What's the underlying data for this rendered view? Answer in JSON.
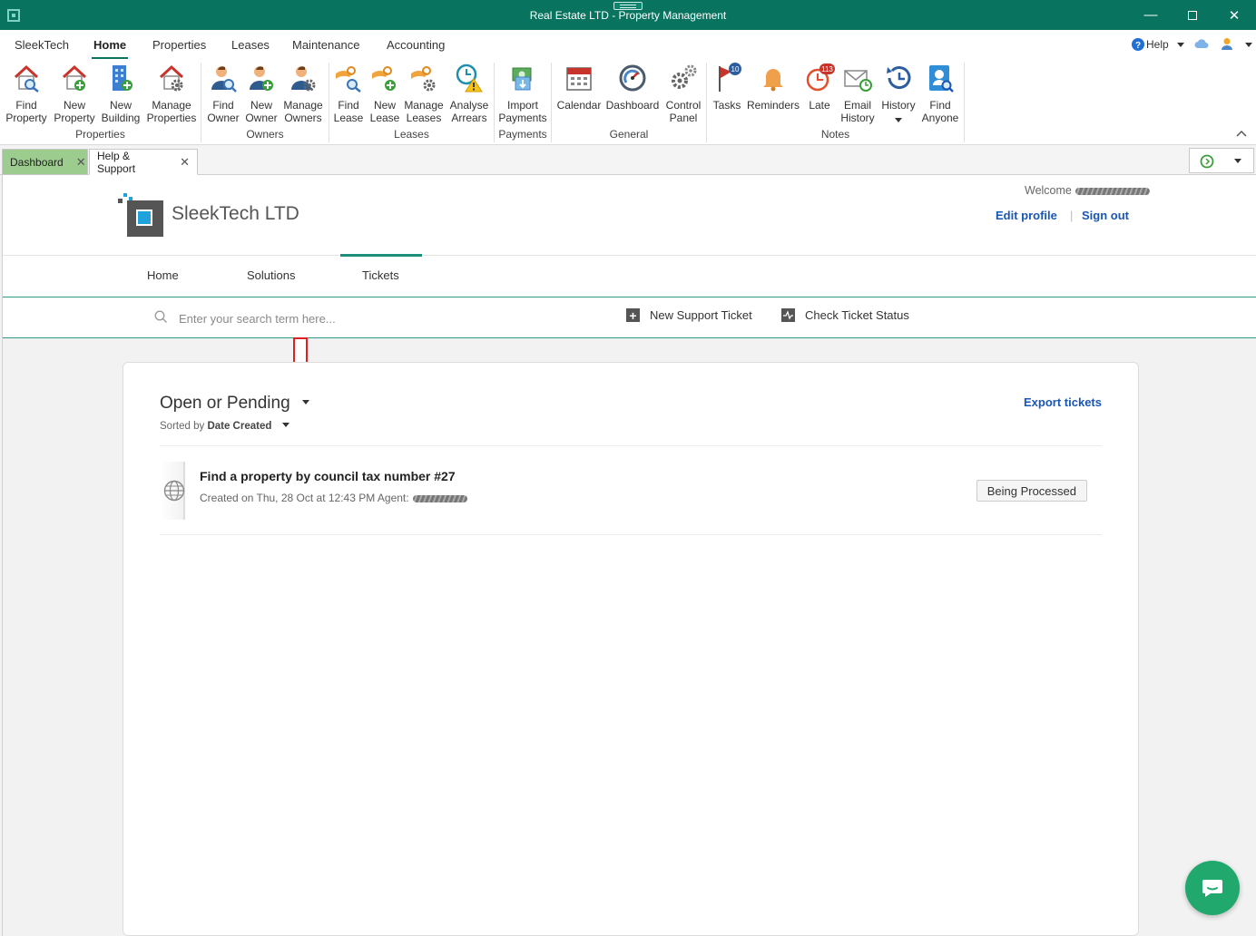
{
  "window": {
    "title": "Real Estate LTD - Property Management"
  },
  "menu": {
    "tabs": [
      "SleekTech",
      "Home",
      "Properties",
      "Leases",
      "Maintenance",
      "Accounting"
    ],
    "help_label": "Help"
  },
  "ribbon": {
    "buttons": [
      {
        "l1": "Find",
        "l2": "Property",
        "icon": "house-search-icon"
      },
      {
        "l1": "New",
        "l2": "Property",
        "icon": "house-add-icon"
      },
      {
        "l1": "New",
        "l2": "Building",
        "icon": "building-add-icon"
      },
      {
        "l1": "Manage",
        "l2": "Properties",
        "icon": "house-gear-icon"
      },
      {
        "l1": "Find",
        "l2": "Owner",
        "icon": "person-search-icon"
      },
      {
        "l1": "New",
        "l2": "Owner",
        "icon": "person-add-icon"
      },
      {
        "l1": "Manage",
        "l2": "Owners",
        "icon": "person-gear-icon"
      },
      {
        "l1": "Find",
        "l2": "Lease",
        "icon": "key-hand-search-icon"
      },
      {
        "l1": "New",
        "l2": "Lease",
        "icon": "key-hand-add-icon"
      },
      {
        "l1": "Manage",
        "l2": "Leases",
        "icon": "key-hand-gear-icon"
      },
      {
        "l1": "Analyse",
        "l2": "Arrears",
        "icon": "clock-warning-icon"
      },
      {
        "l1": "Import",
        "l2": "Payments",
        "icon": "money-import-icon"
      },
      {
        "l1": "Calendar",
        "l2": "",
        "icon": "calendar-icon"
      },
      {
        "l1": "Dashboard",
        "l2": "",
        "icon": "gauge-icon"
      },
      {
        "l1": "Control",
        "l2": "Panel",
        "icon": "gears-icon"
      },
      {
        "l1": "Tasks",
        "l2": "",
        "icon": "flag-icon",
        "badge": "10"
      },
      {
        "l1": "Reminders",
        "l2": "",
        "icon": "bell-icon"
      },
      {
        "l1": "Late",
        "l2": "",
        "icon": "clock-icon",
        "badge": "113"
      },
      {
        "l1": "Email",
        "l2": "History",
        "icon": "email-clock-icon"
      },
      {
        "l1": "History",
        "l2": "",
        "icon": "history-icon"
      },
      {
        "l1": "Find",
        "l2": "Anyone",
        "icon": "contact-search-icon"
      }
    ],
    "groups": [
      "Properties",
      "Owners",
      "Leases",
      "Payments",
      "General",
      "Notes"
    ]
  },
  "doc_tabs": [
    {
      "label": "Dashboard"
    },
    {
      "label": "Help & Support"
    }
  ],
  "portal": {
    "brand": "SleekTech LTD",
    "welcome": "Welcome",
    "edit_profile": "Edit profile",
    "divider": "|",
    "sign_out": "Sign out",
    "nav": [
      "Home",
      "Solutions",
      "Tickets"
    ],
    "search_placeholder": "Enter your search term here...",
    "new_ticket": "New Support Ticket",
    "check_status": "Check Ticket Status"
  },
  "tickets": {
    "filter": "Open or Pending",
    "sorted_prefix": "Sorted by",
    "sorted_field": "Date Created",
    "export": "Export tickets",
    "items": [
      {
        "title": "Find a property by council tax number #27",
        "meta": "Created on Thu, 28 Oct at 12:43 PM Agent:",
        "status": "Being Processed"
      }
    ]
  },
  "colors": {
    "titlebar": "#08735f",
    "link": "#1a56b5",
    "accent": "#1e8f7a",
    "chat": "#21a86d",
    "dashboard_tab": "#9ccc8e"
  }
}
